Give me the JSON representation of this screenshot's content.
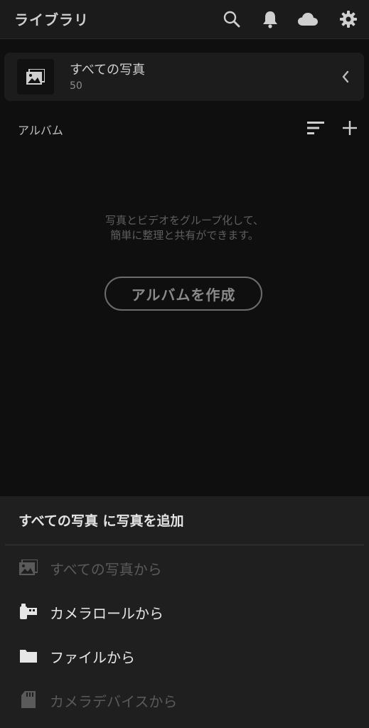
{
  "header": {
    "title": "ライブラリ",
    "icons": [
      "search-icon",
      "bell-icon",
      "cloud-icon",
      "gear-icon"
    ]
  },
  "all_photos": {
    "title": "すべての写真",
    "count": "50",
    "thumb_icon": "photo-icon",
    "chevron_icon": "chevron-left-icon"
  },
  "albums": {
    "label": "アルバム",
    "sort_icon": "sort-icon",
    "add_icon": "plus-icon",
    "empty_line1": "写真とビデオをグループ化して、",
    "empty_line2": "簡単に整理と共有ができます。",
    "create_button": "アルバムを作成"
  },
  "sheet": {
    "title": "すべての写真 に写真を追加",
    "items": [
      {
        "label": "すべての写真から",
        "icon": "photo-icon",
        "enabled": false
      },
      {
        "label": "カメラロールから",
        "icon": "camera-roll-icon",
        "enabled": true
      },
      {
        "label": "ファイルから",
        "icon": "folder-icon",
        "enabled": true
      },
      {
        "label": "カメラデバイスから",
        "icon": "sd-card-icon",
        "enabled": false
      }
    ]
  },
  "colors": {
    "background": "#0f0f0f",
    "header": "#1b1b1b",
    "sheet": "#1f1f1f",
    "text_primary": "#e6e6e6",
    "text_disabled": "#5a5a5a"
  }
}
